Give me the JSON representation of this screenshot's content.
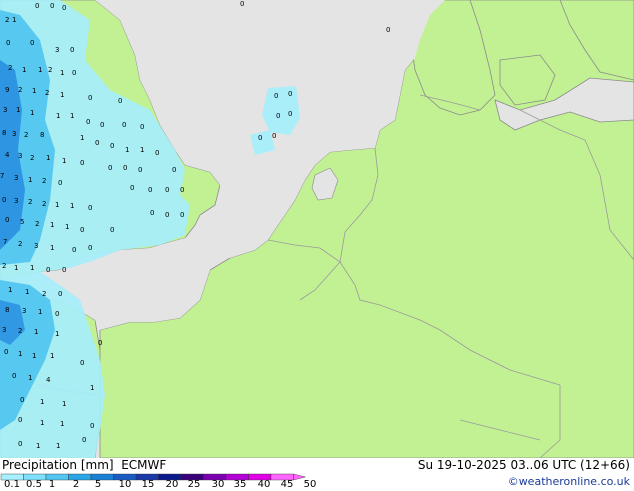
{
  "map": {
    "colors": {
      "sea": "#e4e4e4",
      "land": "#c2f193",
      "coast": "#8a8a8a",
      "border": "#9a9a9a",
      "precip_light": "#a6eefa",
      "precip_mid": "#52c6f0",
      "precip_heavy": "#2a8fe0"
    },
    "precip_labels": [
      "0",
      "1",
      "2",
      "3",
      "4",
      "5",
      "6",
      "7",
      "8",
      "9"
    ]
  },
  "footer": {
    "title": "Precipitation [mm]  ECMWF",
    "datetime": "Su 19-10-2025 03..06 UTC (12+66)",
    "credit": "©weatheronline.co.uk",
    "legend": {
      "colors": [
        "#a6f0ff",
        "#7ee0fa",
        "#52c6f0",
        "#2aa6e6",
        "#1a80d6",
        "#1a5cc2",
        "#1a3aaa",
        "#0a1a8a",
        "#3a007a",
        "#7a00b2",
        "#b200d6",
        "#e200e6",
        "#ff66ff"
      ],
      "ticks": [
        "0.1",
        "0.5",
        "1",
        "2",
        "5",
        "10",
        "15",
        "20",
        "25",
        "30",
        "35",
        "40",
        "45",
        "50"
      ]
    }
  }
}
